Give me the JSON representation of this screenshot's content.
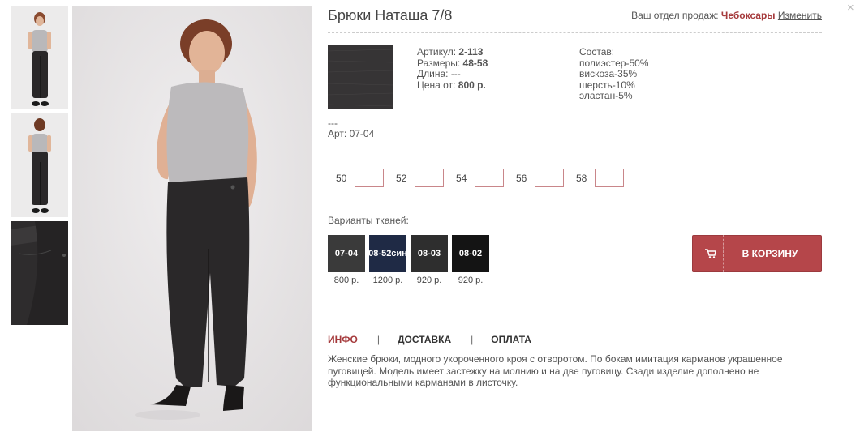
{
  "product": {
    "title": "Брюки Наташа 7/8",
    "specs": {
      "article_label": "Артикул:",
      "article_value": "2-113",
      "sizes_label": "Размеры:",
      "sizes_value": "48-58",
      "length_label": "Длина:",
      "length_value": "---",
      "price_label": "Цена от:",
      "price_value": "800 р."
    },
    "composition": {
      "label": "Состав:",
      "lines": [
        "полиэстер-50%",
        "вискоза-35%",
        "шерсть-10%",
        "эластан-5%"
      ]
    },
    "selected_fabric": {
      "dash": "---",
      "art": "Арт: 07-04"
    }
  },
  "region": {
    "label": "Ваш отдел продаж:",
    "city": "Чебоксары",
    "change": "Изменить"
  },
  "close_glyph": "×",
  "sizes": [
    {
      "label": "50"
    },
    {
      "label": "52"
    },
    {
      "label": "54"
    },
    {
      "label": "56"
    },
    {
      "label": "58"
    }
  ],
  "variants": {
    "title": "Варианты тканей:",
    "items": [
      {
        "code": "07-04",
        "price": "800 р.",
        "color": "#3a3a3a"
      },
      {
        "code": "08-52син",
        "price": "1200 р.",
        "color": "#1f2a45"
      },
      {
        "code": "08-03",
        "price": "920 р.",
        "color": "#2e2e2e"
      },
      {
        "code": "08-02",
        "price": "920 р.",
        "color": "#141414"
      }
    ]
  },
  "cart": {
    "label": "В КОРЗИНУ",
    "color": "#b5464a"
  },
  "tabs": {
    "info": "ИНФО",
    "delivery": "ДОСТАВКА",
    "payment": "ОПЛАТА",
    "separator": "|"
  },
  "description": "Женские брюки, модного укороченного кроя с отворотом. По бокам имитация карманов украшенное пуговицей. Модель имеет застежку на молнию и на две пуговицу. Сзади изделие дополнено не функциональными карманами в листочку.",
  "accent_color": "#a53a3c"
}
